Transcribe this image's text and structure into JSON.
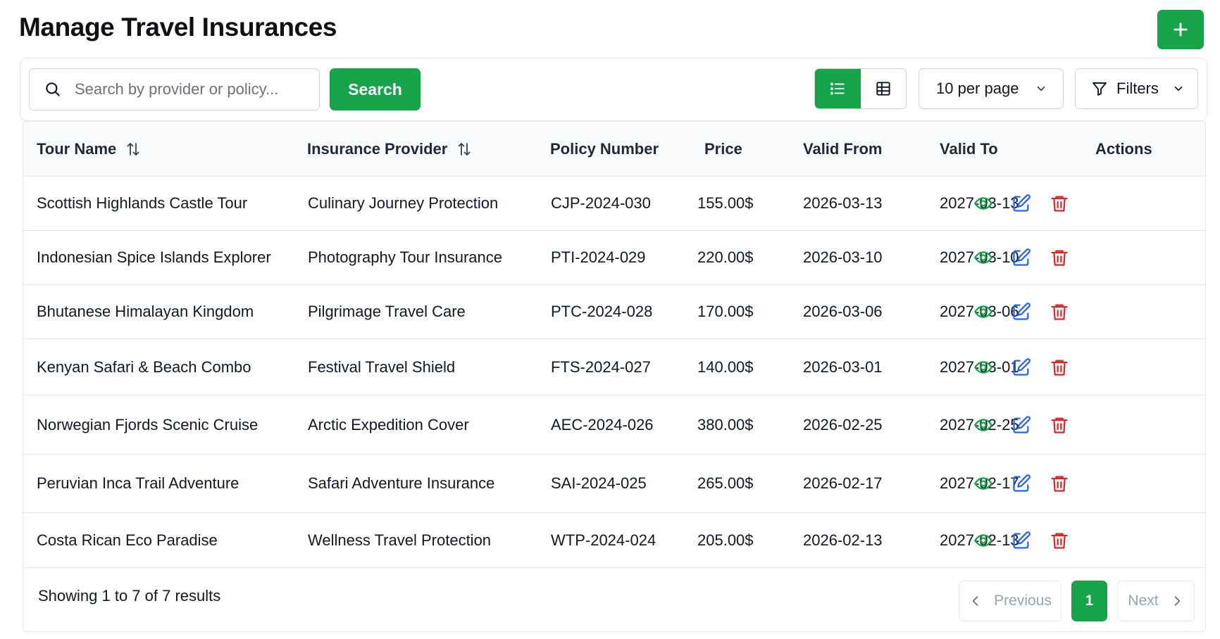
{
  "page": {
    "title": "Manage Travel Insurances",
    "add_button_icon": "plus-icon"
  },
  "toolbar": {
    "search_placeholder": "Search by provider or policy...",
    "search_value": "",
    "search_button": "Search",
    "view_modes": [
      "list-icon",
      "grid-icon"
    ],
    "active_view": "list",
    "per_page": "10 per page",
    "filters": "Filters"
  },
  "table": {
    "columns": {
      "tour_name": "Tour Name",
      "insurance_provider": "Insurance Provider",
      "policy_number": "Policy Number",
      "price": "Price",
      "valid_from": "Valid From",
      "valid_to": "Valid To",
      "actions": "Actions"
    },
    "sortable_columns": [
      "tour_name",
      "insurance_provider"
    ],
    "rows": [
      {
        "tour_name": "Scottish Highlands Castle Tour",
        "insurance_provider": "Culinary Journey Protection",
        "policy_number": "CJP-2024-030",
        "price": "155.00$",
        "valid_from": "2026-03-13",
        "valid_to": "2027-03-13"
      },
      {
        "tour_name": "Indonesian Spice Islands Explorer",
        "insurance_provider": "Photography Tour Insurance",
        "policy_number": "PTI-2024-029",
        "price": "220.00$",
        "valid_from": "2026-03-10",
        "valid_to": "2027-03-10"
      },
      {
        "tour_name": "Bhutanese Himalayan Kingdom",
        "insurance_provider": "Pilgrimage Travel Care",
        "policy_number": "PTC-2024-028",
        "price": "170.00$",
        "valid_from": "2026-03-06",
        "valid_to": "2027-03-06"
      },
      {
        "tour_name": "Kenyan Safari & Beach Combo",
        "insurance_provider": "Festival Travel Shield",
        "policy_number": "FTS-2024-027",
        "price": "140.00$",
        "valid_from": "2026-03-01",
        "valid_to": "2027-03-01"
      },
      {
        "tour_name": "Norwegian Fjords Scenic Cruise",
        "insurance_provider": "Arctic Expedition Cover",
        "policy_number": "AEC-2024-026",
        "price": "380.00$",
        "valid_from": "2026-02-25",
        "valid_to": "2027-02-25"
      },
      {
        "tour_name": "Peruvian Inca Trail Adventure",
        "insurance_provider": "Safari Adventure Insurance",
        "policy_number": "SAI-2024-025",
        "price": "265.00$",
        "valid_from": "2026-02-17",
        "valid_to": "2027-02-17"
      },
      {
        "tour_name": "Costa Rican Eco Paradise",
        "insurance_provider": "Wellness Travel Protection",
        "policy_number": "WTP-2024-024",
        "price": "205.00$",
        "valid_from": "2026-02-13",
        "valid_to": "2027-02-13"
      }
    ],
    "row_actions": [
      "eye-icon",
      "edit-icon",
      "trash-icon"
    ]
  },
  "footer": {
    "summary": "Showing 1 to 7 of 7 results",
    "previous": "Previous",
    "current_page": "1",
    "next": "Next"
  },
  "colors": {
    "primary": "#16a34a",
    "view_icon": "#16a34a",
    "edit_icon": "#2563eb",
    "delete_icon": "#dc2626",
    "border": "#e5e7eb"
  }
}
